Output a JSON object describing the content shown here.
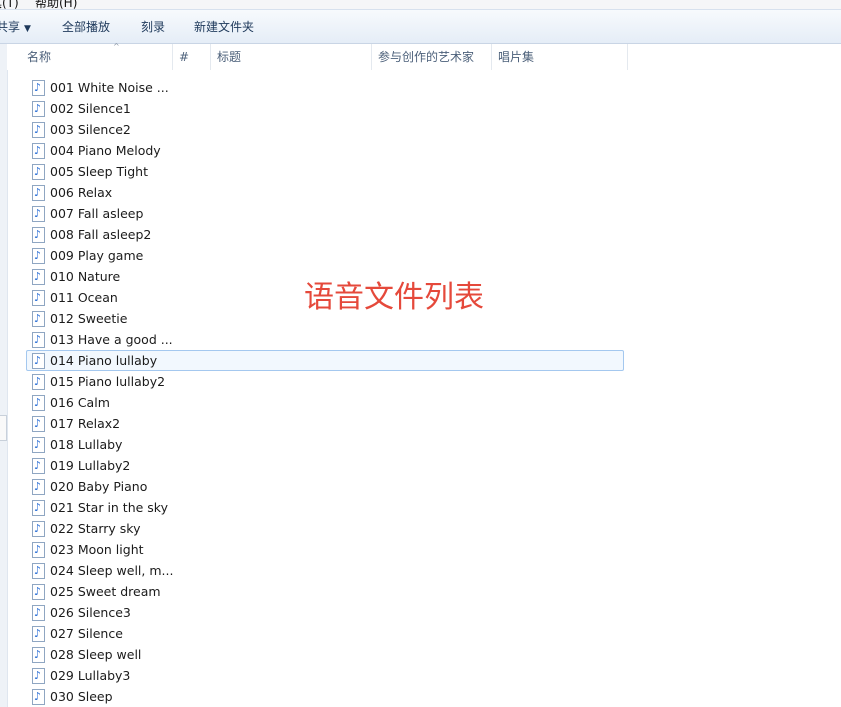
{
  "menubar": {
    "items": [
      {
        "label": "具(T)"
      },
      {
        "label": "帮助(H)"
      }
    ]
  },
  "toolbar": {
    "share_label": "共享",
    "play_all_label": "全部播放",
    "burn_label": "刻录",
    "new_folder_label": "新建文件夹"
  },
  "columns": [
    {
      "label": "名称"
    },
    {
      "label": "#"
    },
    {
      "label": "标题"
    },
    {
      "label": "参与创作的艺术家"
    },
    {
      "label": "唱片集"
    }
  ],
  "files": [
    "001 White Noise ...",
    "002 Silence1",
    "003 Silence2",
    "004 Piano Melody",
    "005 Sleep Tight",
    "006 Relax",
    "007 Fall asleep",
    "008 Fall asleep2",
    "009 Play game",
    "010 Nature",
    "011 Ocean",
    "012 Sweetie",
    "013 Have a good ...",
    "014 Piano lullaby",
    "015 Piano lullaby2",
    "016 Calm",
    "017 Relax2",
    "018 Lullaby",
    "019 Lullaby2",
    "020 Baby Piano",
    "021 Star in the sky",
    "022 Starry sky",
    "023 Moon light",
    "024 Sleep well, m...",
    "025 Sweet dream",
    "026 Silence3",
    "027 Silence",
    "028 Sleep well",
    "029 Lullaby3",
    "030 Sleep"
  ],
  "selected_file": "014 Piano lullaby",
  "file_icon": "audio-file-icon",
  "annotation": "语音文件列表",
  "colors": {
    "annotation": "#e5493b",
    "selection_border": "#a4c8ef",
    "selection_fill": "#f2f8fe",
    "toolbar_text": "#1e395b"
  }
}
